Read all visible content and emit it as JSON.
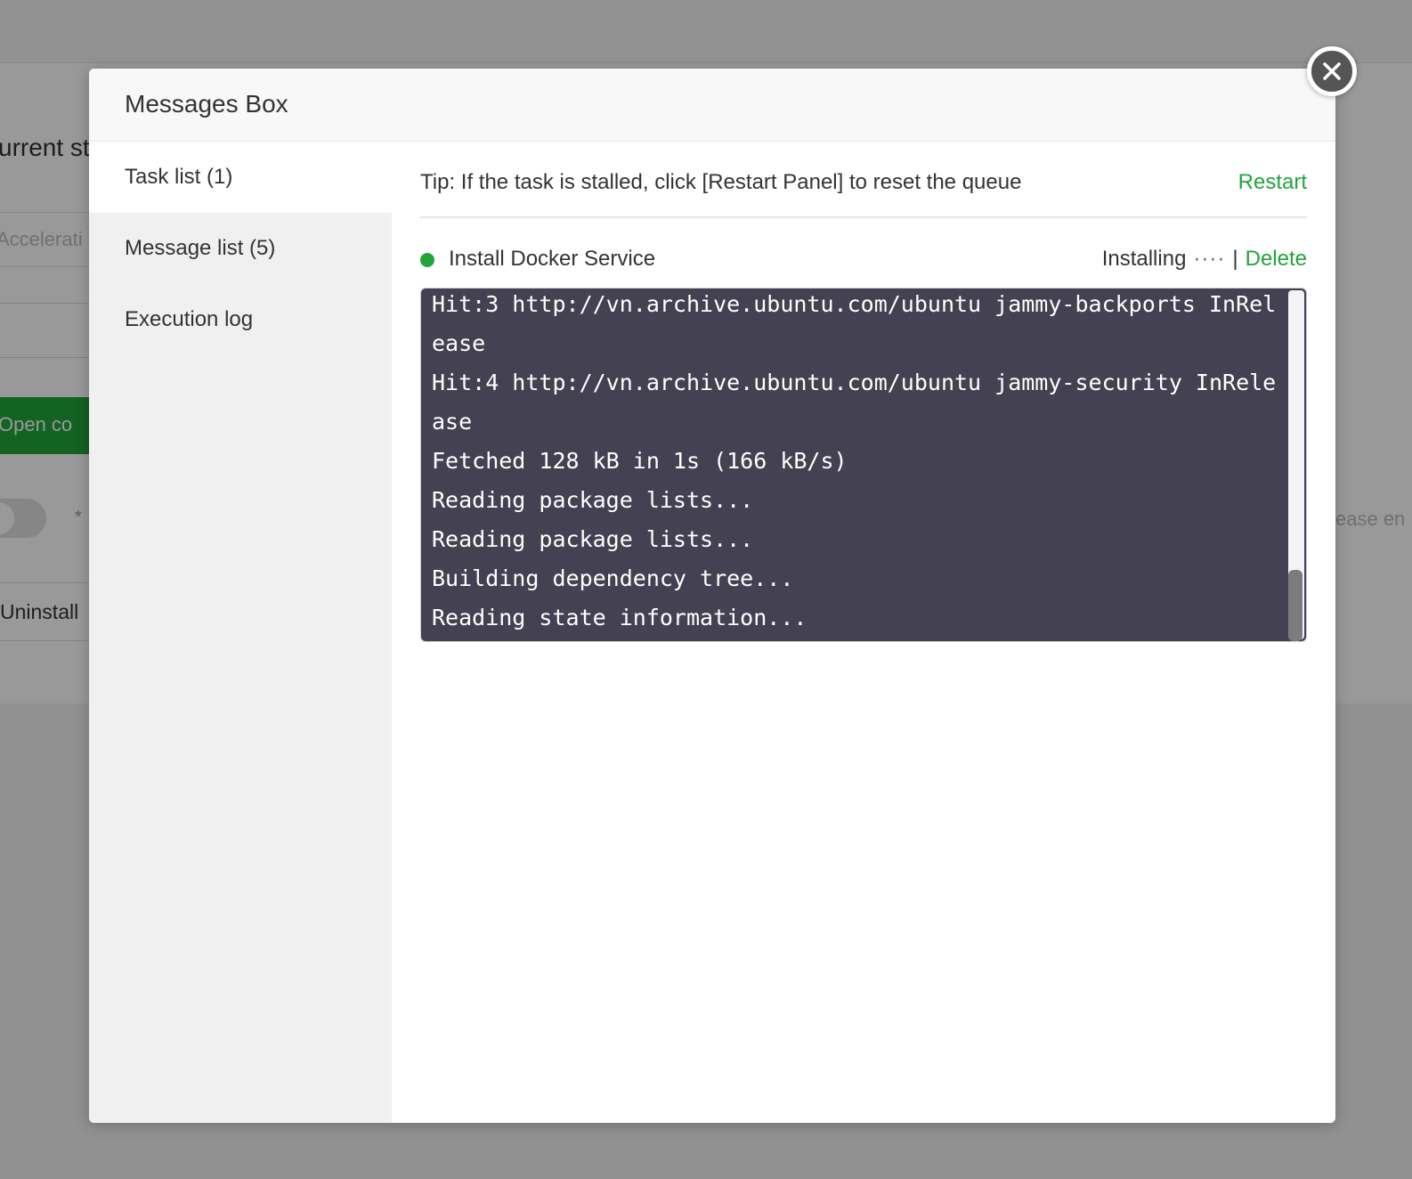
{
  "background": {
    "current_status_fragment": "urrent st",
    "acceleration_placeholder": "Accelerati",
    "open_button_fragment": "Open co",
    "required_mark": "*",
    "please_enter_fragment": "ease en",
    "uninstall_fragment": "Uninstall"
  },
  "modal": {
    "title": "Messages Box",
    "sidebar": {
      "items": [
        {
          "label": "Task list (1)",
          "active": true
        },
        {
          "label": "Message list (5)",
          "active": false
        },
        {
          "label": "Execution log",
          "active": false
        }
      ]
    },
    "tip": {
      "text": "Tip: If the task is stalled, click [Restart Panel] to reset the queue",
      "restart_label": "Restart"
    },
    "task": {
      "name": "Install Docker Service",
      "status": "Installing",
      "status_dots": "····",
      "separator": "|",
      "delete_label": "Delete",
      "status_color": "#20a53a",
      "log": "Hit:3 http://vn.archive.ubuntu.com/ubuntu jammy-backports InRelease\nHit:4 http://vn.archive.ubuntu.com/ubuntu jammy-security InRelease\nFetched 128 kB in 1s (166 kB/s)\nReading package lists...\nReading package lists...\nBuilding dependency tree...\nReading state information..."
    },
    "close_icon": "close-icon"
  },
  "colors": {
    "accent": "#20a53a",
    "terminal_bg": "#444152",
    "sidebar_bg": "#f0f0f0"
  }
}
